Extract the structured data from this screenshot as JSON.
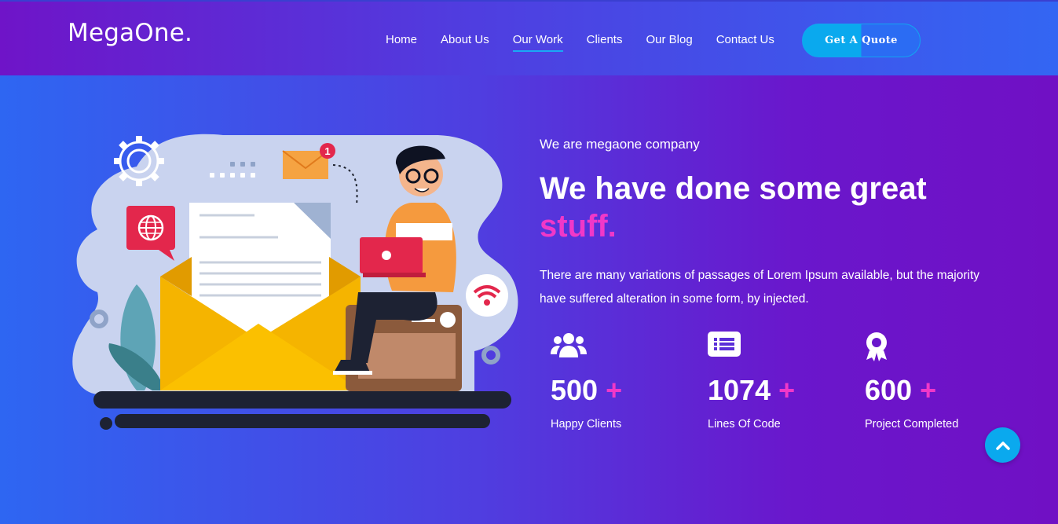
{
  "brand": {
    "logo": "MegaOne."
  },
  "nav": {
    "items": [
      {
        "label": "Home"
      },
      {
        "label": "About Us"
      },
      {
        "label": "Our Work"
      },
      {
        "label": "Clients"
      },
      {
        "label": "Our Blog"
      },
      {
        "label": "Contact Us"
      }
    ],
    "active": "Our Work",
    "cta_label": "Get A Quote"
  },
  "hero": {
    "eyebrow": "We are megaone company",
    "headline": "We have done some great",
    "headline_accent": "stuff.",
    "description": "There are many variations of passages of Lorem Ipsum available, but the majority have suffered alteration in some form, by injected.",
    "notification_count": "1",
    "stats": [
      {
        "icon": "users-icon",
        "value": "500",
        "suffix": "+",
        "label": "Happy Clients"
      },
      {
        "icon": "list-icon",
        "value": "1074",
        "suffix": "+",
        "label": "Lines Of Code"
      },
      {
        "icon": "award-icon",
        "value": "600",
        "suffix": "+",
        "label": "Project Completed"
      }
    ]
  },
  "colors": {
    "accent_pink": "#f038c8",
    "accent_blue": "#0aa9ee",
    "gradient_start": "#2e66f2",
    "gradient_end": "#7010c4"
  }
}
